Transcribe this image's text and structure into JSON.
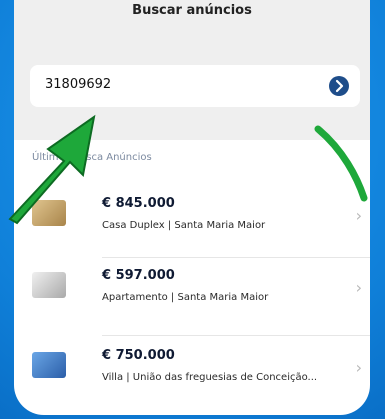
{
  "page": {
    "title": "Buscar anúncios"
  },
  "search": {
    "value": "31809692"
  },
  "section": {
    "label": "Últimos Busca Anúncios"
  },
  "listings": [
    {
      "price": "€ 845.000",
      "description": "Casa Duplex  |  Santa Maria Maior",
      "thumb_color": "#c7a76d"
    },
    {
      "price": "€ 597.000",
      "description": "Apartamento  |  Santa Maria Maior",
      "thumb_color": "#cfcfcf"
    },
    {
      "price": "€ 750.000",
      "description": "Villa  |  União das freguesias de Conceição...",
      "thumb_color": "#3a6fb8"
    }
  ],
  "icons": {
    "submit": "chevron-right-icon",
    "row_chevron": "chevron-right-icon",
    "callout_left": "green-arrow",
    "callout_right": "green-arc-arrow"
  },
  "colors": {
    "background": "#1a8fe6",
    "callout": "#1ea83a",
    "submit": "#1e4d8a"
  }
}
